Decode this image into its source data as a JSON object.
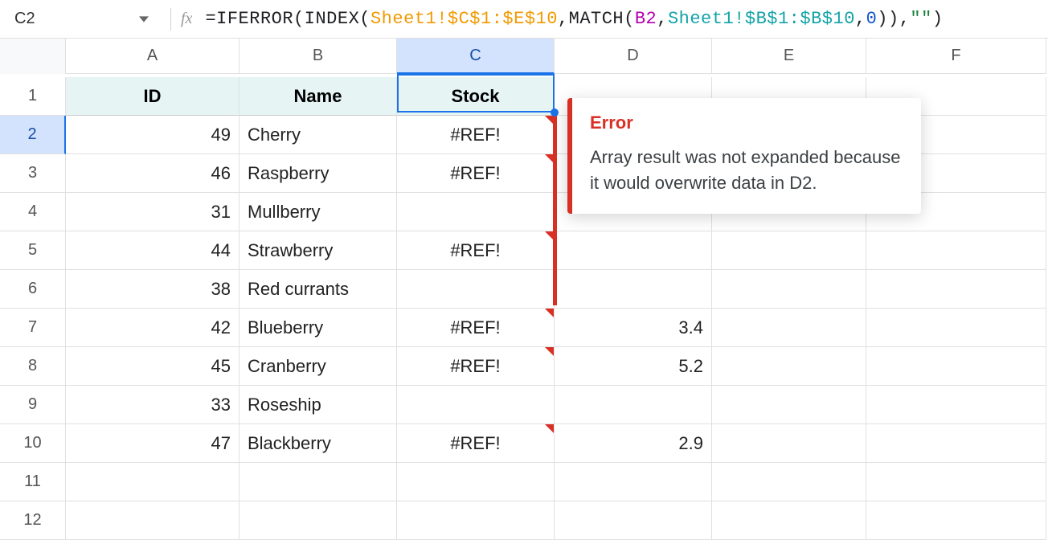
{
  "namebox": "C2",
  "fx_label": "fx",
  "formula": {
    "p1": "=IFERROR(INDEX(",
    "range1": "Sheet1!$C$1:$E$10",
    "p2": ",MATCH(",
    "arg_b2": "B2",
    "p3": ",",
    "range2": "Sheet1!$B$1:$B$10",
    "p4": ",",
    "zero": "0",
    "p5": ")),",
    "empty": "\"\"",
    "p6": ")"
  },
  "columns": [
    "A",
    "B",
    "C",
    "D",
    "E",
    "F"
  ],
  "rownums": [
    "1",
    "2",
    "3",
    "4",
    "5",
    "6",
    "7",
    "8",
    "9",
    "10",
    "11",
    "12"
  ],
  "headers": {
    "A": "ID",
    "B": "Name",
    "C": "Stock"
  },
  "rows": [
    {
      "A": "49",
      "B": "Cherry",
      "C": "#REF!",
      "D": ""
    },
    {
      "A": "46",
      "B": "Raspberry",
      "C": "#REF!",
      "D": ""
    },
    {
      "A": "31",
      "B": "Mullberry",
      "C": "",
      "D": ""
    },
    {
      "A": "44",
      "B": "Strawberry",
      "C": "#REF!",
      "D": ""
    },
    {
      "A": "38",
      "B": "Red currants",
      "C": "",
      "D": ""
    },
    {
      "A": "42",
      "B": "Blueberry",
      "C": "#REF!",
      "D": "3.4"
    },
    {
      "A": "45",
      "B": "Cranberry",
      "C": "#REF!",
      "D": "5.2"
    },
    {
      "A": "33",
      "B": "Roseship",
      "C": "",
      "D": ""
    },
    {
      "A": "47",
      "B": "Blackberry",
      "C": "#REF!",
      "D": "2.9"
    }
  ],
  "tooltip": {
    "title": "Error",
    "body": "Array result was not expanded because it would overwrite data in D2."
  }
}
